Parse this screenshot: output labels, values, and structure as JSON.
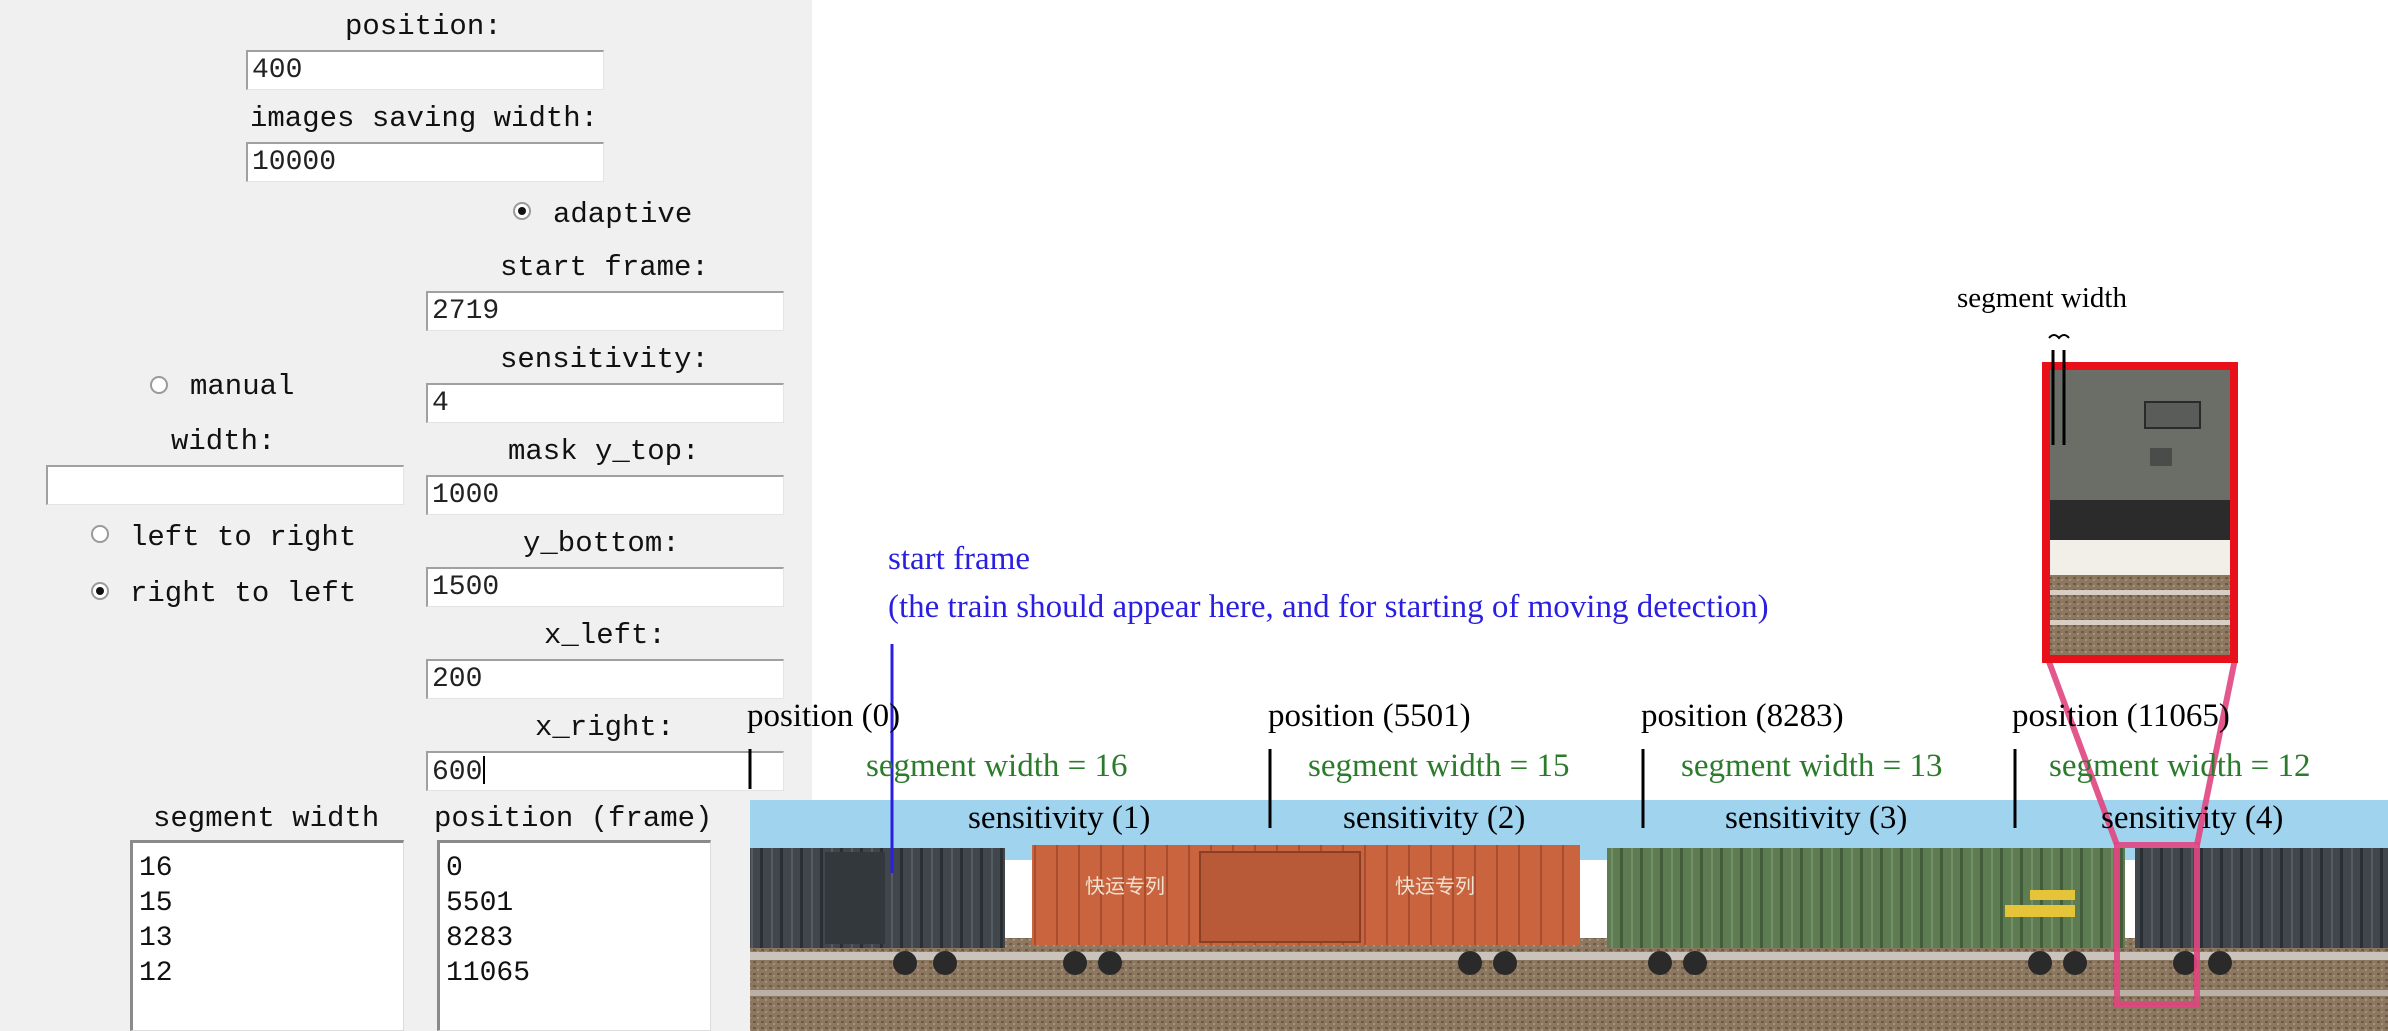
{
  "form": {
    "position_label": "position:",
    "position_value": "400",
    "saving_width_label": "images saving width:",
    "saving_width_value": "10000",
    "adaptive_label": "adaptive",
    "manual_label": "manual",
    "width_label": "width:",
    "width_value": "",
    "start_frame_label": "start frame:",
    "start_frame_value": "2719",
    "sensitivity_label": "sensitivity:",
    "sensitivity_value": "4",
    "mask_y_top_label": "mask y_top:",
    "mask_y_top_value": "1000",
    "y_bottom_label": "y_bottom:",
    "y_bottom_value": "1500",
    "x_left_label": "x_left:",
    "x_left_value": "200",
    "x_right_label": "x_right:",
    "x_right_value": "600",
    "ltr_label": "left to right",
    "rtl_label": "right to left",
    "segment_width_header": "segment width",
    "position_frame_header": "position (frame)",
    "segment_widths": [
      "16",
      "15",
      "13",
      "12"
    ],
    "positions": [
      "0",
      "5501",
      "8283",
      "11065"
    ]
  },
  "annotations": {
    "start_frame_title": "start frame",
    "start_frame_note": "(the train should appear here, and for starting of moving detection)",
    "segment_width_top": "segment width",
    "positions": [
      "position (0)",
      "position (5501)",
      "position (8283)",
      "position (11065)"
    ],
    "segment_widths": [
      "segment width = 16",
      "segment width = 15",
      "segment width = 13",
      "segment width = 12"
    ],
    "sensitivities": [
      "sensitivity (1)",
      "sensitivity (2)",
      "sensitivity (3)",
      "sensitivity (4)"
    ],
    "car_lettering": [
      "快运专列",
      "快运专列"
    ]
  },
  "colors": {
    "panel_bg": "#f0f0f0",
    "annotation_blue": "#2a1fe0",
    "annotation_green": "#2c7a2c",
    "highlight_red": "#e8101a",
    "zoom_pink": "#e0457f",
    "sky": "#9fd3ee",
    "car_dark": "#3f4448",
    "car_orange": "#c8613f",
    "car_green": "#5c7b50"
  }
}
